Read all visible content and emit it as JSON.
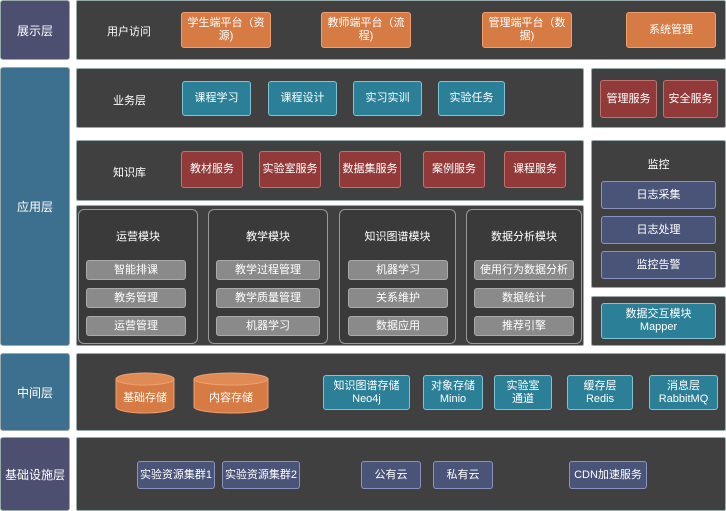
{
  "layers": {
    "presentation": "展示层",
    "application": "应用层",
    "middle": "中间层",
    "infrastructure": "基础设施层"
  },
  "presentation": {
    "label": "用户访问",
    "items": [
      "学生端平台（资源)",
      "教师端平台（流程)",
      "管理端平台（数据)",
      "系统管理"
    ]
  },
  "business": {
    "label": "业务层",
    "items": [
      "课程学习",
      "课程设计",
      "实习实训",
      "实验任务"
    ]
  },
  "knowledge": {
    "label": "知识库",
    "items": [
      "教材服务",
      "实验室服务",
      "数据集服务",
      "案例服务",
      "课程服务"
    ]
  },
  "side_services": [
    "管理服务",
    "安全服务"
  ],
  "monitor": {
    "title": "监控",
    "items": [
      "日志采集",
      "日志处理",
      "监控告警"
    ]
  },
  "modules": [
    {
      "title": "运营模块",
      "items": [
        "智能排课",
        "教务管理",
        "运营管理"
      ]
    },
    {
      "title": "教学模块",
      "items": [
        "教学过程管理",
        "教学质量管理",
        "机器学习"
      ]
    },
    {
      "title": "知识图谱模块",
      "items": [
        "机器学习",
        "关系维护",
        "数据应用"
      ]
    },
    {
      "title": "数据分析模块",
      "items": [
        "使用行为数据分析",
        "数据统计",
        "推荐引擎"
      ]
    }
  ],
  "data_exchange": {
    "line1": "数据交互模块",
    "line2": "Mapper"
  },
  "middle": {
    "cylinders": [
      "基础存储",
      "内容存储"
    ],
    "items": [
      {
        "line1": "知识图谱存储",
        "line2": "Neo4j"
      },
      {
        "line1": "对象存储",
        "line2": "Minio"
      },
      {
        "line1": "实验室",
        "line2": "通道"
      },
      {
        "line1": "缓存层",
        "line2": "Redis"
      },
      {
        "line1": "消息层",
        "line2": "RabbitMQ"
      }
    ]
  },
  "infra": {
    "items": [
      "实验资源集群1",
      "实验资源集群2",
      "公有云",
      "私有云",
      "CDN加速服务"
    ]
  },
  "colors": {
    "orange": "#d77b45",
    "teal": "#2b7f96",
    "red": "#923a3a",
    "slate": "#4a5378",
    "panel": "#404040",
    "layer_blue": "#3d6f8f",
    "layer_purple": "#4c4f70"
  }
}
